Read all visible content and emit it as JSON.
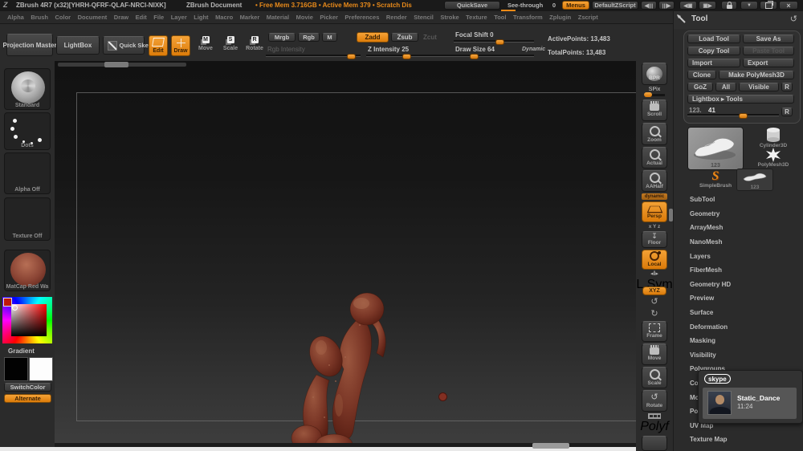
{
  "colors": {
    "accent": "#ee8a16",
    "panel_bg": "#2b2b2b",
    "canvas_top": "#121212",
    "canvas_bottom": "#3d3d3d",
    "sculpt_base": "#7c3a28"
  },
  "title_bar": {
    "app_title": "ZBrush 4R7 (x32)[YHRH-QFRF-QLAF-NRCI-NIXK]",
    "document_title": "ZBrush Document",
    "memory_status": "• Free Mem 3.716GB • Active Mem 379 • Scratch Dis",
    "quicksave_label": "QuickSave",
    "see_through_label": "See-through",
    "see_through_value": "0",
    "menus_label": "Menus",
    "zscript_label": "DefaultZScript"
  },
  "menu_bar": {
    "items": [
      "Alpha",
      "Brush",
      "Color",
      "Document",
      "Draw",
      "Edit",
      "File",
      "Layer",
      "Light",
      "Macro",
      "Marker",
      "Material",
      "Movie",
      "Picker",
      "Preferences",
      "Render",
      "Stencil",
      "Stroke",
      "Texture",
      "Tool",
      "Transform",
      "Zplugin",
      "Zscript"
    ]
  },
  "shelf": {
    "projection_master": "Projection Master",
    "lightbox": "LightBox",
    "quick_sketch": "Quick Sketch",
    "edit": "Edit",
    "draw": "Draw",
    "move": "Move",
    "scale": "Scale",
    "rotate": "Rotate",
    "mrgb": "Mrgb",
    "rgb": "Rgb",
    "m": "M",
    "rgb_intensity": "Rgb Intensity",
    "zadd": "Zadd",
    "zsub": "Zsub",
    "zcut": "Zcut",
    "z_intensity": "Z Intensity 25",
    "focal_shift": "Focal Shift 0",
    "draw_size": "Draw Size 64",
    "dynamic": "Dynamic",
    "active_points": "ActivePoints: 13,483",
    "total_points": "TotalPoints: 13,483"
  },
  "left_sidebar": {
    "brush_label": "Standard",
    "stroke_label": "Dots",
    "alpha_label": "Alpha Off",
    "texture_label": "Texture Off",
    "material_label": "MatCap Red Wa",
    "gradient_label": "Gradient",
    "switch_color": "SwitchColor",
    "alternate": "Alternate"
  },
  "right_strip": {
    "bpr": "BPR",
    "spix": "SPix",
    "scroll": "Scroll",
    "zoom": "Zoom",
    "actual": "Actual",
    "aahalf": "AAHalf",
    "dynamic": "dynamic",
    "persp": "Persp",
    "floor_axes": "x Y z",
    "floor": "Floor",
    "local": "Local",
    "lsym": "L.Sym",
    "xyz": "XYZ",
    "frame": "Frame",
    "move": "Move",
    "scale": "Scale",
    "rotate": "Rotate",
    "polyf": "Polyf"
  },
  "tool_panel": {
    "header": "Tool",
    "load_tool": "Load Tool",
    "save_as": "Save As",
    "copy_tool": "Copy Tool",
    "paste_tool": "Paste Tool",
    "import": "Import",
    "export": "Export",
    "clone": "Clone",
    "make_polymesh3d": "Make PolyMesh3D",
    "goz": "GoZ",
    "all": "All",
    "visible": "Visible",
    "r": "R",
    "lightbox_tools": "Lightbox ▸ Tools",
    "slider_label": "123.",
    "slider_value": "41",
    "slider_r": "R",
    "active_tool_name": "123",
    "cylinder": "Cylinder3D",
    "polymesh": "PolyMesh3D",
    "simplebrush": "SimpleBrush",
    "recent_tool_name": "123",
    "sections": [
      "SubTool",
      "Geometry",
      "ArrayMesh",
      "NanoMesh",
      "Layers",
      "FiberMesh",
      "Geometry HD",
      "Preview",
      "Surface",
      "Deformation",
      "Masking",
      "Visibility",
      "Polygroups",
      "Co",
      "Mo",
      "Pol",
      "UV Map",
      "Texture Map"
    ]
  },
  "skype": {
    "logo_text": "skype",
    "contact_name": "Static_Dance",
    "time": "11:24"
  },
  "icons": {
    "zbrush_logo": "Z",
    "panel_collapse_left": "◀|||",
    "panel_collapse_right": "|||▶",
    "window_left": "◀▣",
    "window_right": "▣▶",
    "minimize": "▼",
    "close": "×",
    "reset": "↺",
    "spin_y": "↺",
    "spin_z": "↻",
    "floor_arrow": "↧",
    "lsym_arrows": "◂‖▸"
  }
}
